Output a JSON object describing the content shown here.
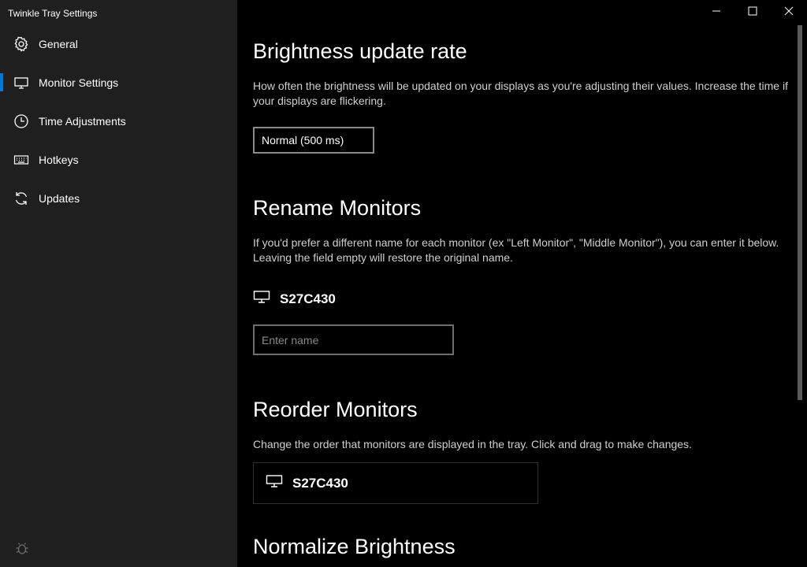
{
  "app": {
    "title": "Twinkle Tray Settings"
  },
  "sidebar": {
    "items": [
      {
        "label": "General",
        "icon": "gear-icon",
        "active": false
      },
      {
        "label": "Monitor Settings",
        "icon": "monitor-icon",
        "active": true
      },
      {
        "label": "Time Adjustments",
        "icon": "clock-icon",
        "active": false
      },
      {
        "label": "Hotkeys",
        "icon": "keyboard-icon",
        "active": false
      },
      {
        "label": "Updates",
        "icon": "refresh-icon",
        "active": false
      }
    ],
    "footer_icon": "bug-icon"
  },
  "window_controls": [
    "minimize-icon",
    "maximize-icon",
    "close-icon"
  ],
  "sections": {
    "update_rate": {
      "title": "Brightness update rate",
      "description": "How often the brightness will be updated on your displays as you're adjusting their values. Increase the time if your displays are flickering.",
      "selected": "Normal (500 ms)"
    },
    "rename": {
      "title": "Rename Monitors",
      "description": "If you'd prefer a different name for each monitor (ex \"Left Monitor\", \"Middle Monitor\"), you can enter it below. Leaving the field empty will restore the original name.",
      "monitor_name": "S27C430",
      "input_value": "",
      "input_placeholder": "Enter name"
    },
    "reorder": {
      "title": "Reorder Monitors",
      "description": "Change the order that monitors are displayed in the tray. Click and drag to make changes.",
      "monitor_name": "S27C430"
    },
    "normalize": {
      "title": "Normalize Brightness"
    }
  },
  "colors": {
    "accent": "#0078d7",
    "sidebar_bg": "#1f1f1f",
    "content_bg": "#000000"
  }
}
